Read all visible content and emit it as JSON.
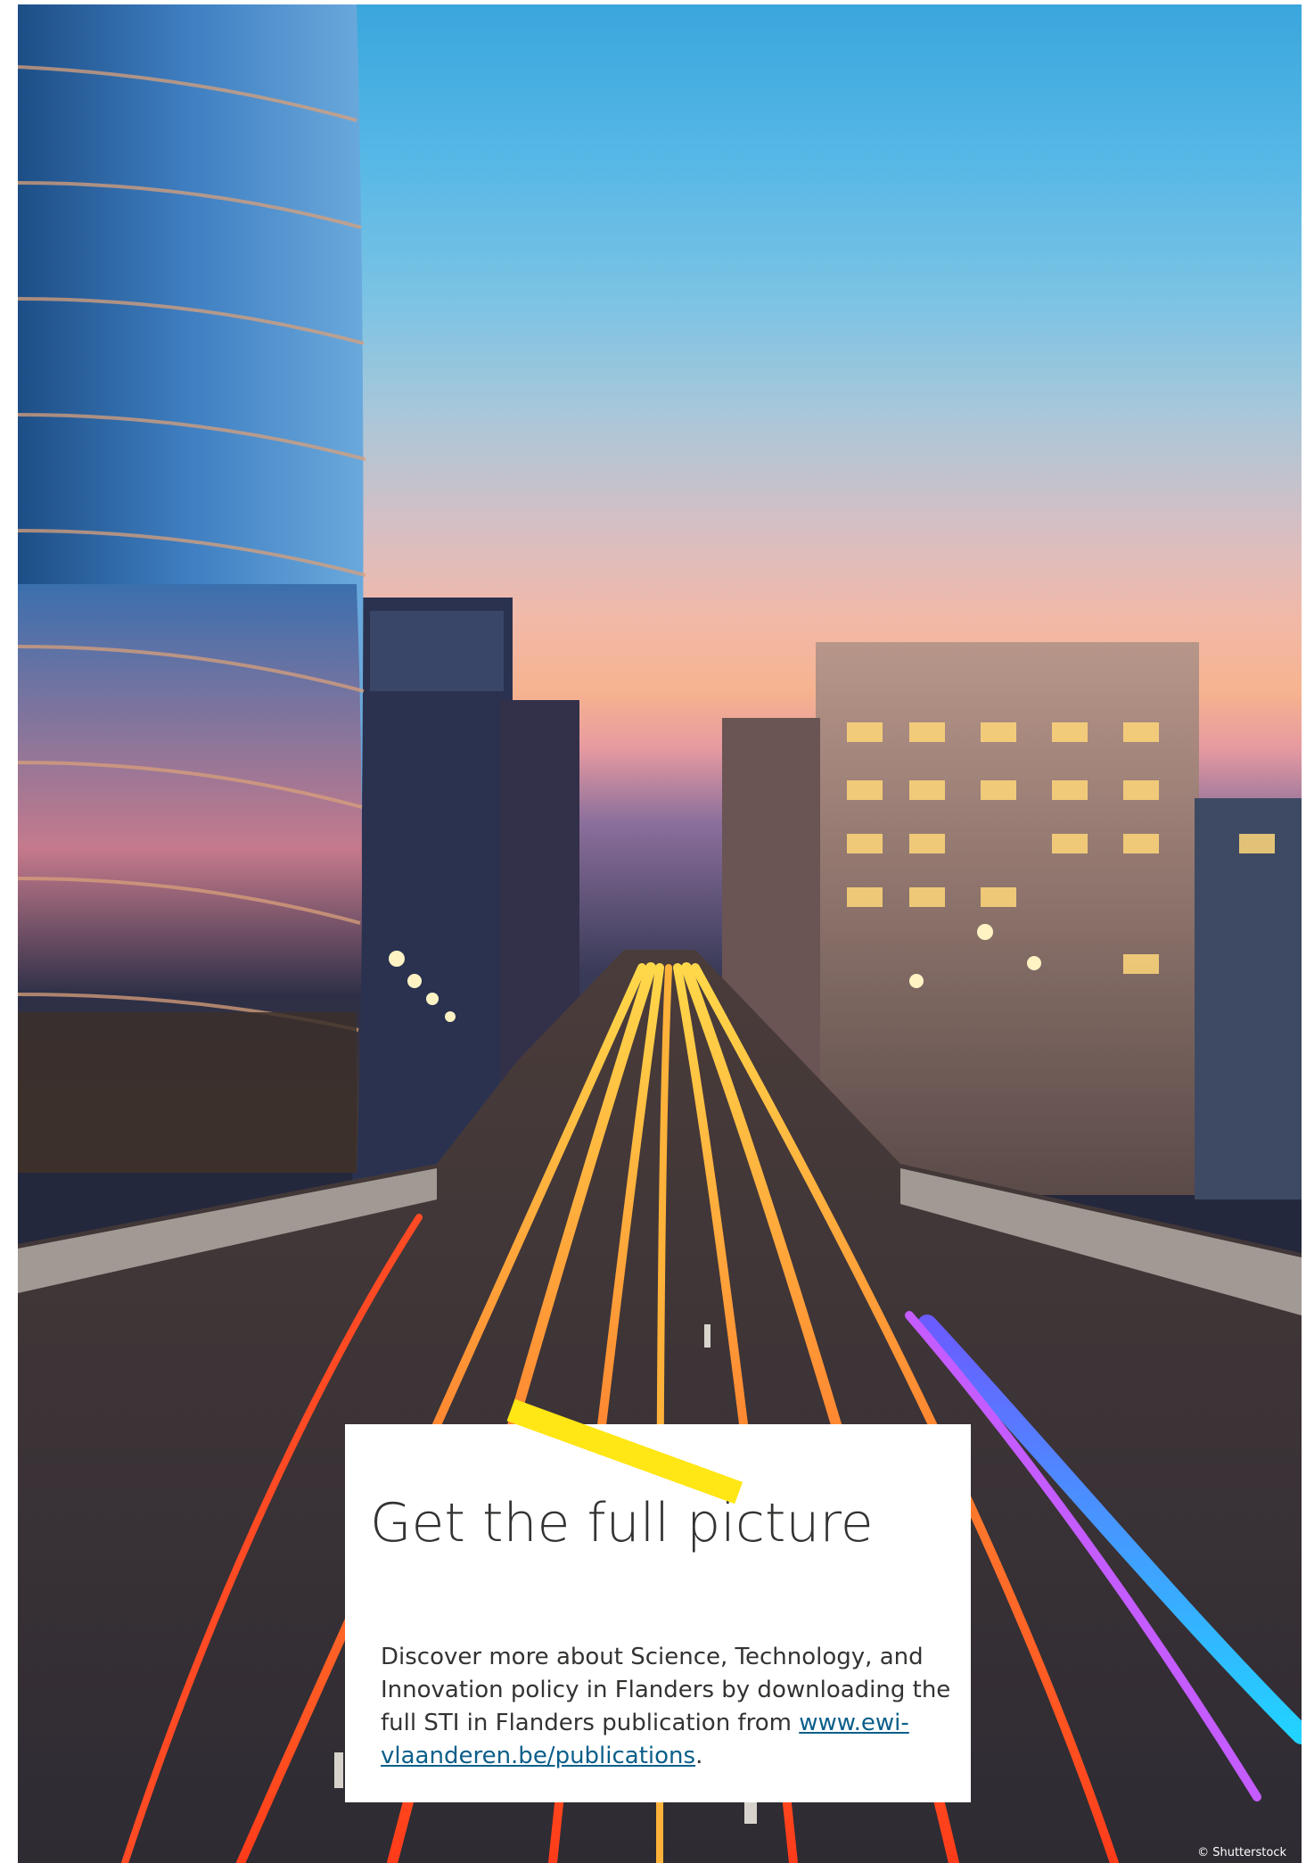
{
  "card": {
    "title": "Get the full picture",
    "body_text": "Discover more about Science, Technology, and Innovation policy in Flanders by downloading the full STI in Flanders publication from ",
    "link_text": "www.ewi-vlaanderen.be/publications",
    "trailing_text": "."
  },
  "photo": {
    "credit": "© Shutterstock"
  },
  "colors": {
    "accent": "#ffe615",
    "text": "#333332",
    "link": "#0b5f8a",
    "sky_top": "#3aa6dc",
    "sky_horizon": "#f6b38f",
    "light_trail": "#ff5a1e"
  }
}
